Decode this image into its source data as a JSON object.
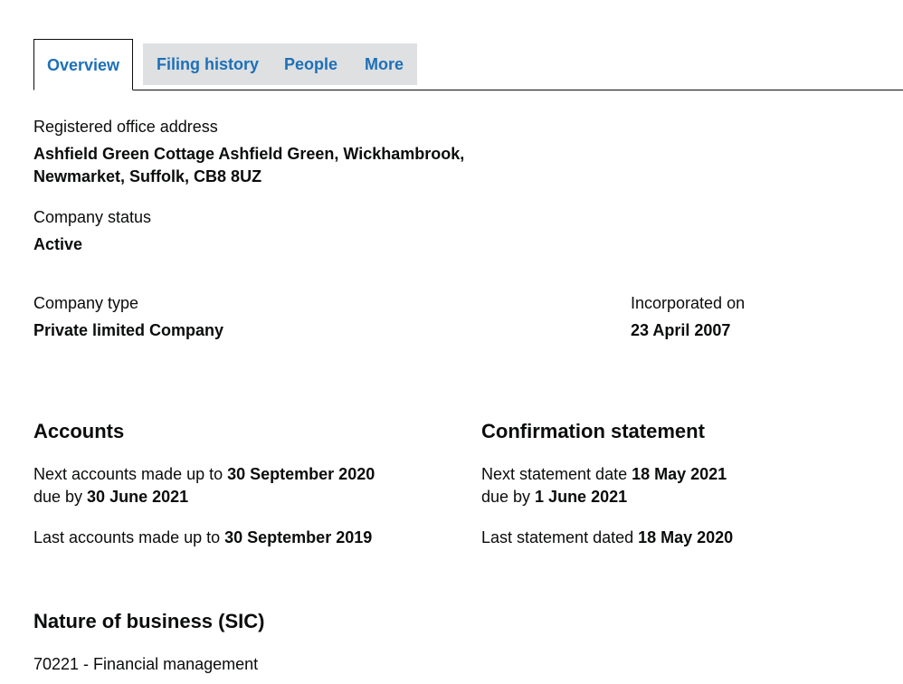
{
  "tabs": [
    {
      "label": "Overview",
      "active": true
    },
    {
      "label": "Filing history",
      "active": false
    },
    {
      "label": "People",
      "active": false
    },
    {
      "label": "More",
      "active": false
    }
  ],
  "registered_office": {
    "label": "Registered office address",
    "value_line1": "Ashfield Green Cottage Ashfield Green, Wickhambrook,",
    "value_line2": "Newmarket, Suffolk, CB8 8UZ"
  },
  "company_status": {
    "label": "Company status",
    "value": "Active"
  },
  "company_type": {
    "label": "Company type",
    "value": "Private limited Company"
  },
  "incorporated": {
    "label": "Incorporated on",
    "value": "23 April 2007"
  },
  "accounts": {
    "heading": "Accounts",
    "next_prefix": "Next accounts made up to ",
    "next_date": "30 September 2020",
    "due_prefix": "due by ",
    "due_date": "30 June 2021",
    "last_prefix": "Last accounts made up to ",
    "last_date": "30 September 2019"
  },
  "confirmation": {
    "heading": "Confirmation statement",
    "next_prefix": "Next statement date ",
    "next_date": "18 May 2021",
    "due_prefix": "due by ",
    "due_date": "1 June 2021",
    "last_prefix": "Last statement dated ",
    "last_date": "18 May 2020"
  },
  "sic": {
    "heading": "Nature of business (SIC)",
    "item": "70221 - Financial management"
  },
  "colors": {
    "link": "#1d70b8",
    "tab_bg": "#dee0e2",
    "text": "#0b0c0c"
  }
}
